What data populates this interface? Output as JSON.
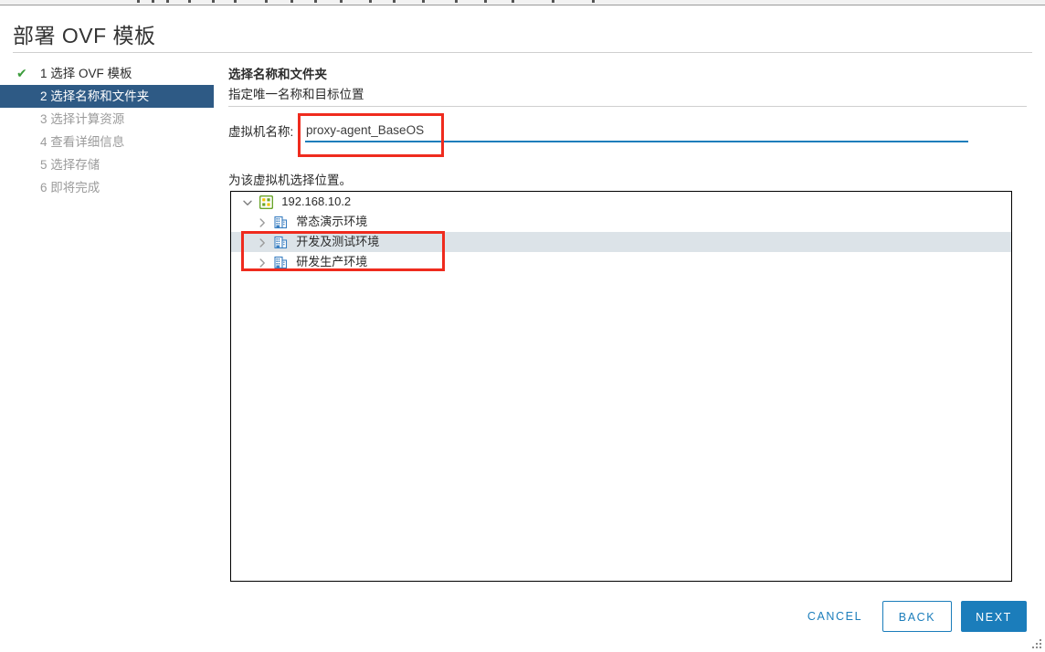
{
  "window": {
    "title": "部署 OVF 模板"
  },
  "steps": [
    {
      "number": "1",
      "label": "1 选择 OVF 模板",
      "state": "done",
      "check": "✔"
    },
    {
      "number": "2",
      "label": "2 选择名称和文件夹",
      "state": "active",
      "check": ""
    },
    {
      "number": "3",
      "label": "3 选择计算资源",
      "state": "pending",
      "check": ""
    },
    {
      "number": "4",
      "label": "4 查看详细信息",
      "state": "pending",
      "check": ""
    },
    {
      "number": "5",
      "label": "5 选择存储",
      "state": "pending",
      "check": ""
    },
    {
      "number": "6",
      "label": "6 即将完成",
      "state": "pending",
      "check": ""
    }
  ],
  "panel": {
    "heading": "选择名称和文件夹",
    "subheading": "指定唯一名称和目标位置",
    "vm_name_label": "虚拟机名称:",
    "vm_name_value": "proxy-agent_BaseOS",
    "vm_name_placeholder": "",
    "location_label": "为该虚拟机选择位置。"
  },
  "tree": [
    {
      "level": 0,
      "label": "192.168.10.2",
      "icon": "vcenter-icon",
      "expanded": true,
      "selected": false
    },
    {
      "level": 1,
      "label": "常态演示环境",
      "icon": "datacenter-icon",
      "expanded": false,
      "selected": false
    },
    {
      "level": 1,
      "label": "开发及测试环境",
      "icon": "datacenter-icon",
      "expanded": false,
      "selected": true
    },
    {
      "level": 1,
      "label": "研发生产环境",
      "icon": "datacenter-icon",
      "expanded": false,
      "selected": false
    }
  ],
  "footer": {
    "cancel": "CANCEL",
    "back": "BACK",
    "next": "NEXT"
  },
  "colors": {
    "accent": "#1b7dbb",
    "active_step_bg": "#2e5a85",
    "selected_row_bg": "#dce3e8",
    "check_green": "#3c9c3c",
    "annotation_red": "#ef2b1e"
  }
}
